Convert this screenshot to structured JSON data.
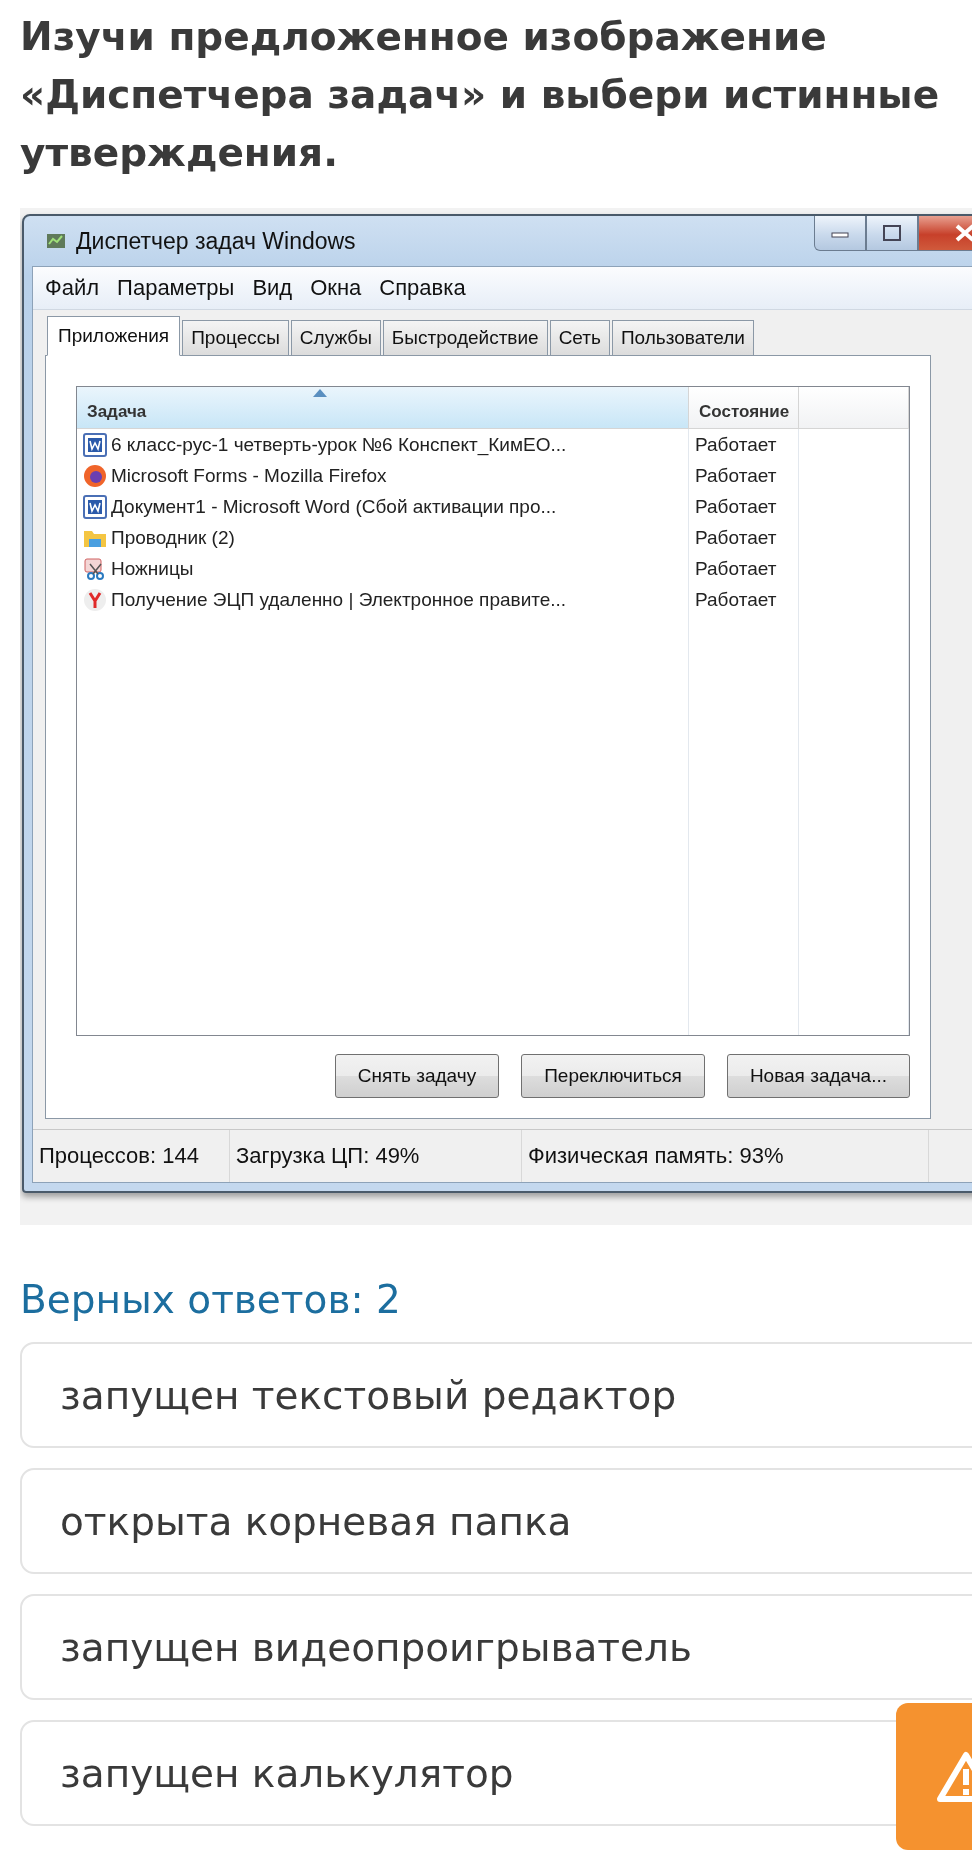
{
  "question": {
    "title": "Изучи предложенное изображение «Диспетчера задач» и выбери истинные утверждения."
  },
  "task_manager": {
    "window_title": "Диспетчер задач Windows",
    "menu": [
      "Файл",
      "Параметры",
      "Вид",
      "Окна",
      "Справка"
    ],
    "tabs": [
      {
        "label": "Приложения",
        "selected": true
      },
      {
        "label": "Процессы",
        "selected": false
      },
      {
        "label": "Службы",
        "selected": false
      },
      {
        "label": "Быстродействие",
        "selected": false
      },
      {
        "label": "Сеть",
        "selected": false
      },
      {
        "label": "Пользователи",
        "selected": false
      }
    ],
    "columns": [
      "Задача",
      "Состояние"
    ],
    "rows": [
      {
        "kind": "word",
        "task": "6 класс-рус-1 четверть-урок №6 Конспект_КимЕО...",
        "status": "Работает"
      },
      {
        "kind": "firefox",
        "task": "Microsoft Forms - Mozilla Firefox",
        "status": "Работает"
      },
      {
        "kind": "word",
        "task": "Документ1 - Microsoft Word (Сбой активации про...",
        "status": "Работает"
      },
      {
        "kind": "explorer",
        "task": "Проводник (2)",
        "status": "Работает"
      },
      {
        "kind": "scissors",
        "task": "Ножницы",
        "status": "Работает"
      },
      {
        "kind": "yandex",
        "task": "Получение ЭЦП удаленно | Электронное правите...",
        "status": "Работает"
      }
    ],
    "buttons": [
      "Снять задачу",
      "Переключиться",
      "Новая задача..."
    ],
    "status_bar": [
      "Процессов: 144",
      "Загрузка ЦП: 49%",
      "Физическая память: 93%"
    ]
  },
  "answers_count": "Верных ответов: 2",
  "options": [
    "запущен текстовый редактор",
    "открыта корневая папка",
    "запущен видеопроигрыватель",
    "запущен калькулятор"
  ]
}
